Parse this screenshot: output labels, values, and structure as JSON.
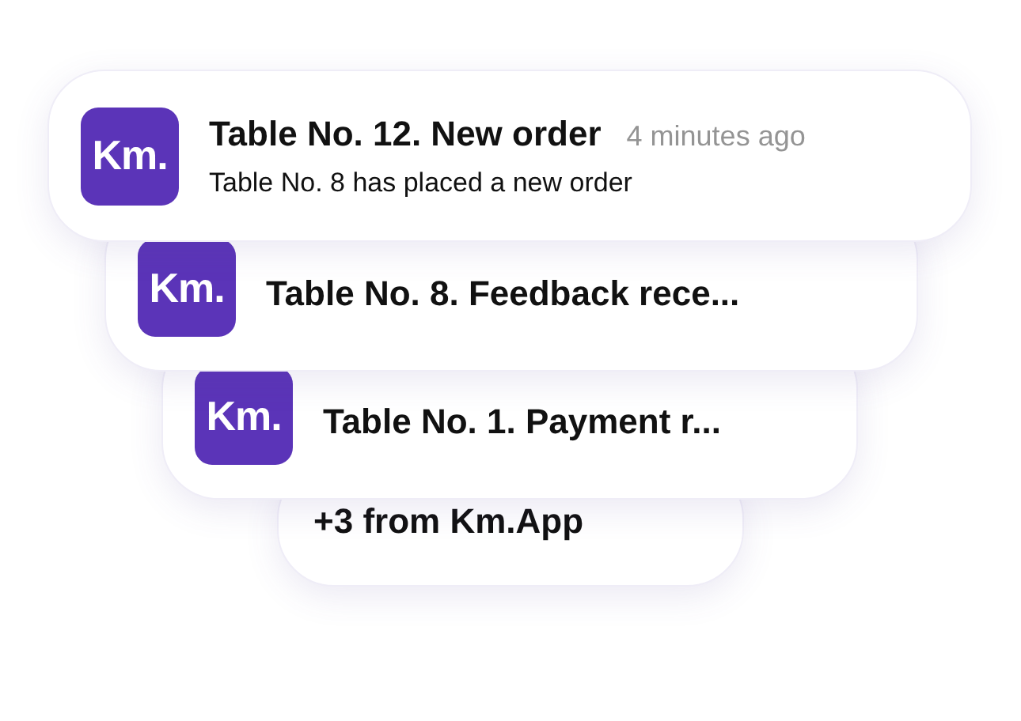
{
  "notifications": [
    {
      "logo": "Km.",
      "title": "Table No. 12. New order",
      "time": "4 minutes ago",
      "body": "Table No. 8 has placed a new order"
    },
    {
      "logo": "Km.",
      "title": "Table No. 8. Feedback rece..."
    },
    {
      "logo": "Km.",
      "title": "Table No. 1. Payment r..."
    }
  ],
  "more": "+3 from Km.App"
}
